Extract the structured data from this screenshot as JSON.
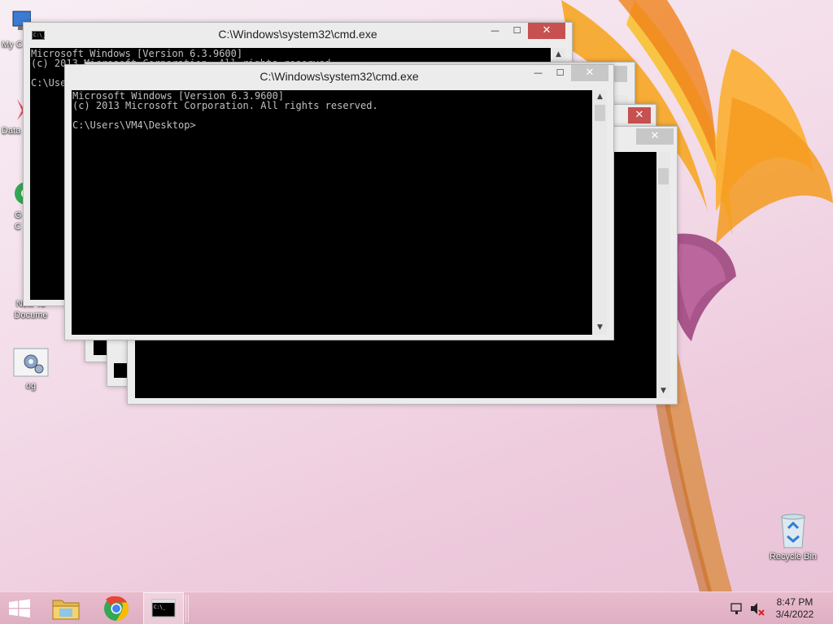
{
  "desktop": {
    "icons": [
      {
        "label": "My C"
      },
      {
        "label": "Data"
      },
      {
        "label": "G\nC"
      },
      {
        "label": "New Te\nDocume"
      },
      {
        "label": "og"
      },
      {
        "label": "Recycle Bin"
      }
    ]
  },
  "windows": [
    {
      "title": "C:\\Windows\\system32\\cmd.exe",
      "console_text": "Microsoft Windows [Version 6.3.9600]\n(c) 2013 Microsoft Corporation. All rights reserved.\n\nC:\\Use"
    },
    {
      "title": "",
      "console_text": ""
    },
    {
      "title": "",
      "console_text": ""
    },
    {
      "title": "C:\\Windows\\system32\\cmd.exe",
      "console_text": "Microsoft Windows [Version 6.3.9600]\n(c) 2013 Microsoft Corporation. All rights reserved.\n\nC:\\Users\\VM4\\Desktop>"
    }
  ],
  "window_controls": {
    "minimize": "—",
    "maximize": "☐",
    "close": "✕"
  },
  "taskbar": {
    "clock_time": "8:47 PM",
    "clock_date": "3/4/2022",
    "colors": {
      "close_active": "#c75050",
      "taskbar": "#dfaec2"
    }
  },
  "icons": [
    "start-icon",
    "file-explorer-icon",
    "chrome-icon",
    "cmd-icon",
    "network-icon",
    "speaker-muted-icon",
    "recycle-bin-icon"
  ]
}
